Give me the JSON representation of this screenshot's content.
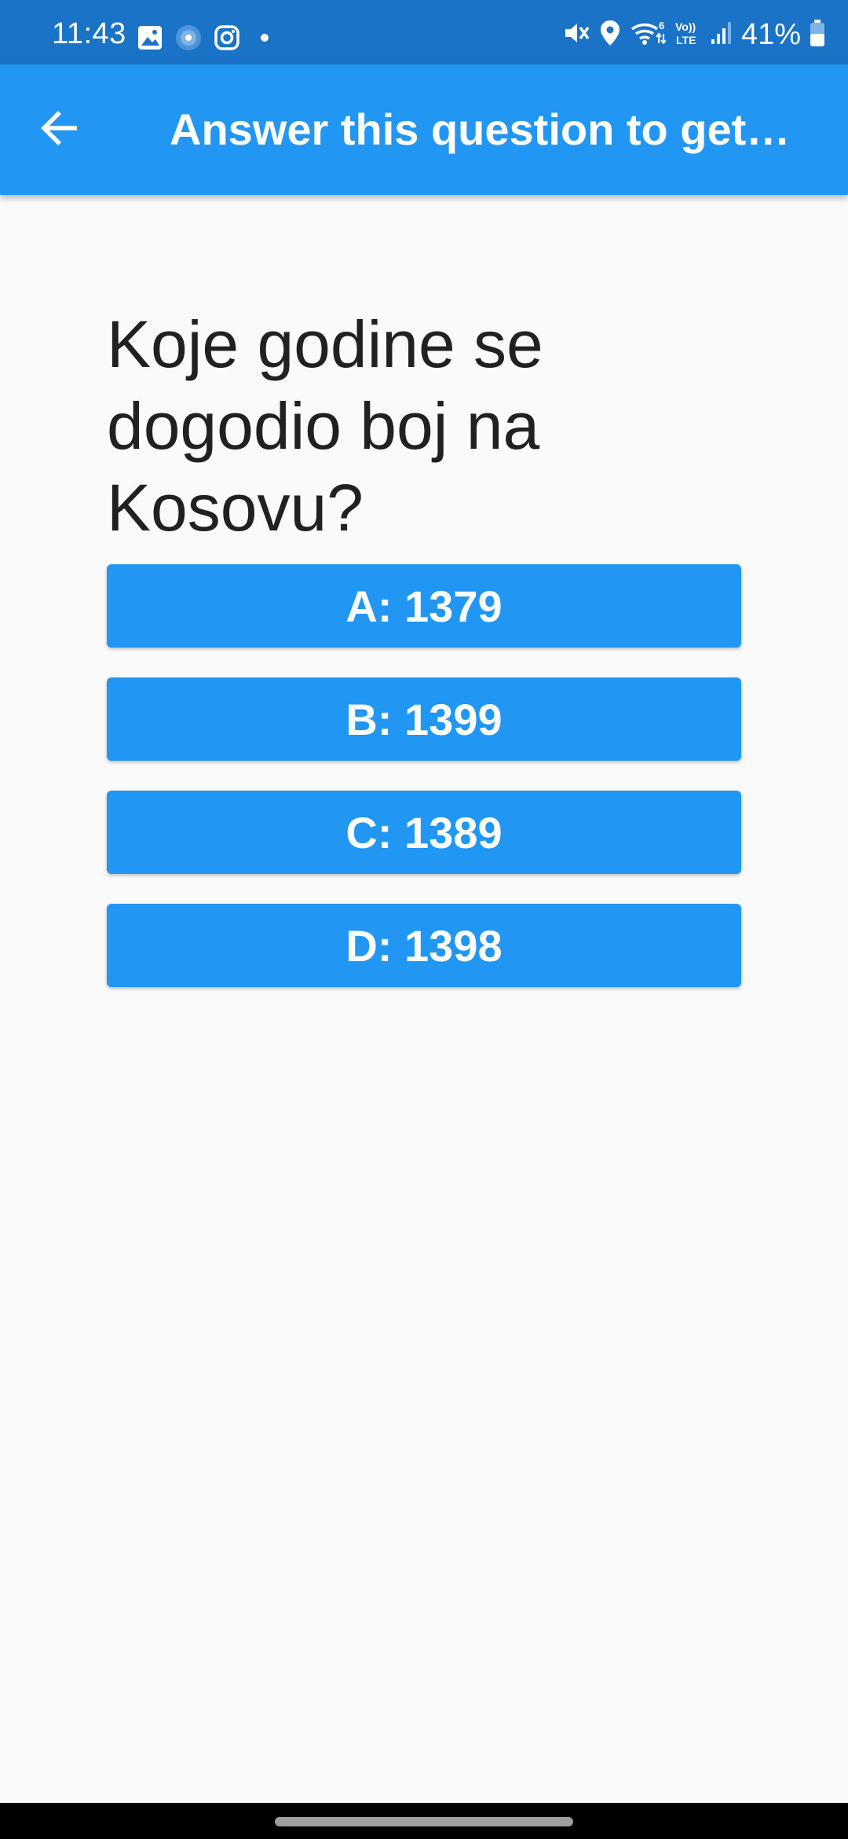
{
  "status_bar": {
    "time": "11:43",
    "battery": "41%",
    "icons": [
      "gallery-icon",
      "radio-dot-icon",
      "instagram-icon",
      "notification-dot-icon",
      "mute-icon",
      "location-icon",
      "wifi-6-icon",
      "volte-icon",
      "signal-icon",
      "battery-icon"
    ]
  },
  "app_bar": {
    "title": "Answer this question to get …",
    "back_icon": "arrow-back-icon",
    "color": "#2196f3"
  },
  "quiz": {
    "question": "Koje godine se dogodio boj na Kosovu?",
    "answers": [
      {
        "label": "A: 1379"
      },
      {
        "label": "B: 1399"
      },
      {
        "label": "C: 1389"
      },
      {
        "label": "D: 1398"
      }
    ]
  },
  "colors": {
    "status_bar": "#1a73c6",
    "accent": "#2196f3",
    "background": "#fafafa",
    "text": "#212121"
  }
}
